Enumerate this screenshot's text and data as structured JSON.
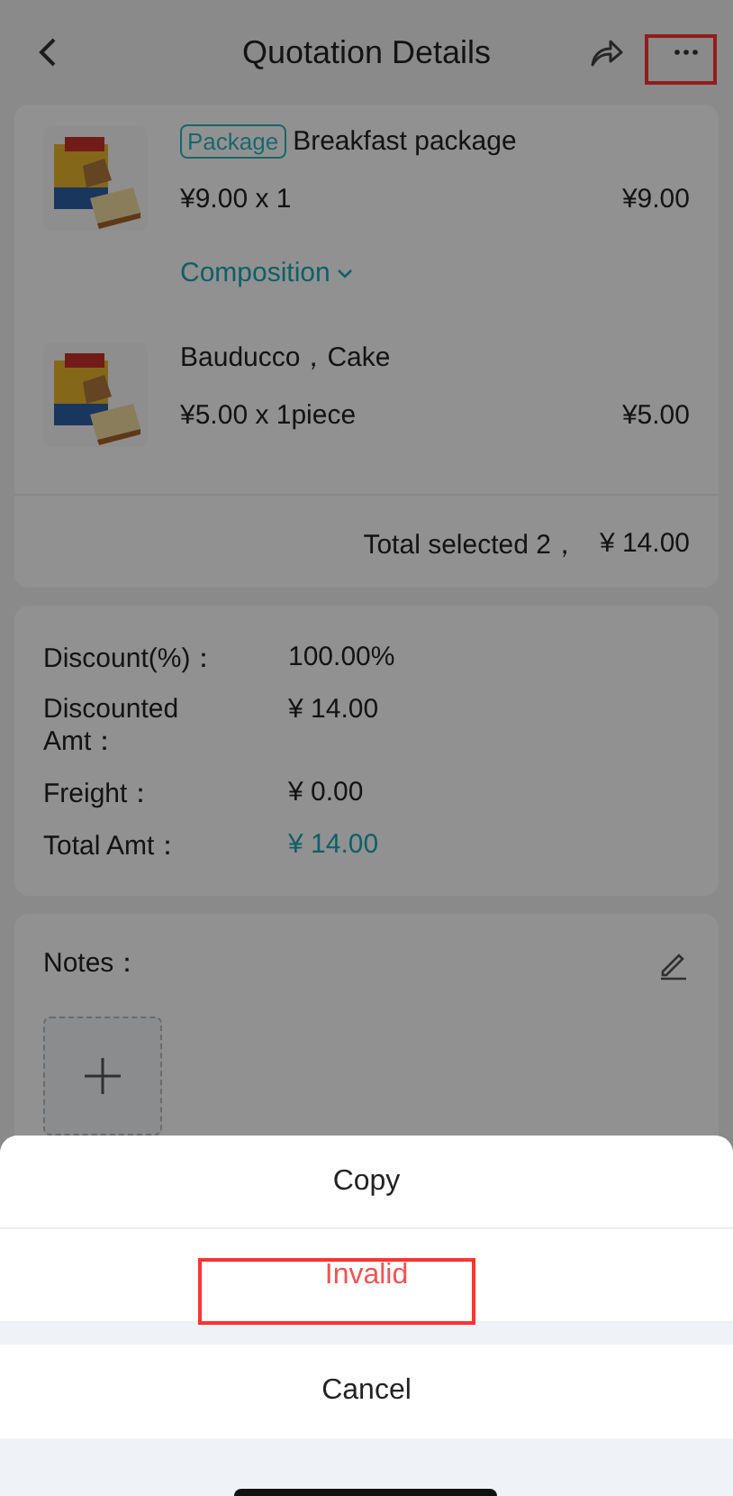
{
  "header": {
    "title": "Quotation Details",
    "more_highlighted": true
  },
  "products": [
    {
      "tag": "Package",
      "name": "Breakfast package",
      "price": "¥9.00 x 1",
      "amount": "¥9.00",
      "link": "Composition"
    },
    {
      "name": "Bauducco，Cake",
      "price": "¥5.00 x 1piece",
      "amount": "¥5.00"
    }
  ],
  "total": {
    "label": "Total selected 2，",
    "amount": "¥ 14.00"
  },
  "summary": [
    {
      "label": "Discount(%)：",
      "value": "100.00%",
      "accent": false
    },
    {
      "label": "Discounted Amt：",
      "value": "¥ 14.00",
      "accent": false
    },
    {
      "label": "Freight：",
      "value": "¥ 0.00",
      "accent": false
    },
    {
      "label": "Total Amt：",
      "value": "¥ 14.00",
      "accent": true
    }
  ],
  "notes": {
    "label": "Notes："
  },
  "action_sheet": {
    "items": [
      {
        "label": "Copy",
        "danger": false,
        "highlighted": false
      },
      {
        "label": "Invalid",
        "danger": true,
        "highlighted": true
      }
    ],
    "cancel": "Cancel"
  }
}
